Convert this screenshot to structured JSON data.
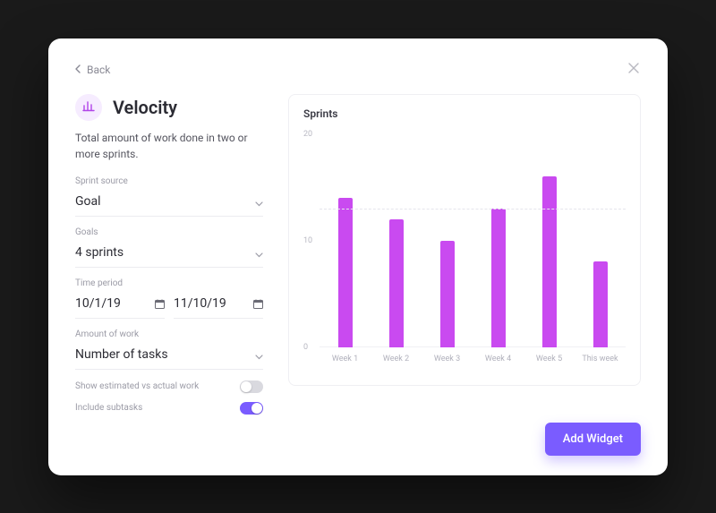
{
  "nav": {
    "back_label": "Back"
  },
  "page": {
    "title": "Velocity",
    "description": "Total amount of work done in two or more sprints."
  },
  "fields": {
    "sprint_source": {
      "label": "Sprint source",
      "value": "Goal"
    },
    "goals": {
      "label": "Goals",
      "value": "4 sprints"
    },
    "time_period": {
      "label": "Time period",
      "start": "10/1/19",
      "end": "11/10/19"
    },
    "amount_of_work": {
      "label": "Amount of work",
      "value": "Number of tasks"
    }
  },
  "toggles": {
    "estimated_vs_actual": {
      "label": "Show estimated vs actual work",
      "on": false
    },
    "include_subtasks": {
      "label": "Include subtasks",
      "on": true
    }
  },
  "chart": {
    "title": "Sprints"
  },
  "chart_data": {
    "type": "bar",
    "title": "Sprints",
    "xlabel": "",
    "ylabel": "",
    "ylim": [
      0,
      20
    ],
    "yticks": [
      0,
      10,
      20
    ],
    "guideline_at": 13,
    "categories": [
      "Week 1",
      "Week 2",
      "Week 3",
      "Week 4",
      "Week 5",
      "This week"
    ],
    "values": [
      14,
      12,
      10,
      13,
      16,
      8
    ]
  },
  "actions": {
    "add_widget": "Add Widget"
  },
  "colors": {
    "bar": "#c94af0",
    "accent": "#7a5cff"
  }
}
